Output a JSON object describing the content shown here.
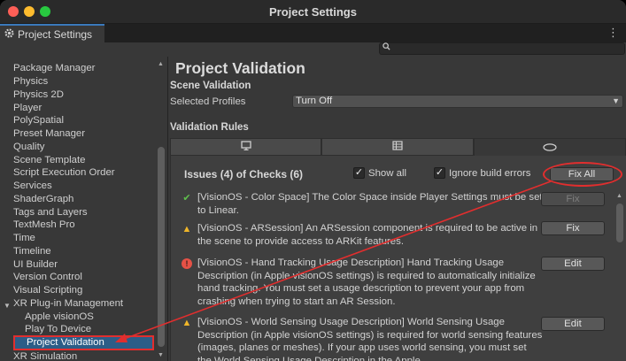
{
  "window": {
    "title": "Project Settings",
    "tab_label": "Project Settings",
    "tab_icon": "gear-icon",
    "menu_icon": "kebab-menu-icon",
    "search_placeholder": ""
  },
  "sidebar": {
    "items": [
      {
        "label": "Package Manager",
        "level": 0
      },
      {
        "label": "Physics",
        "level": 0
      },
      {
        "label": "Physics 2D",
        "level": 0
      },
      {
        "label": "Player",
        "level": 0
      },
      {
        "label": "PolySpatial",
        "level": 0
      },
      {
        "label": "Preset Manager",
        "level": 0
      },
      {
        "label": "Quality",
        "level": 0
      },
      {
        "label": "Scene Template",
        "level": 0
      },
      {
        "label": "Script Execution Order",
        "level": 0
      },
      {
        "label": "Services",
        "level": 0
      },
      {
        "label": "ShaderGraph",
        "level": 0
      },
      {
        "label": "Tags and Layers",
        "level": 0
      },
      {
        "label": "TextMesh Pro",
        "level": 0
      },
      {
        "label": "Time",
        "level": 0
      },
      {
        "label": "Timeline",
        "level": 0
      },
      {
        "label": "UI Builder",
        "level": 0
      },
      {
        "label": "Version Control",
        "level": 0
      },
      {
        "label": "Visual Scripting",
        "level": 0
      },
      {
        "label": "XR Plug-in Management",
        "level": 0
      },
      {
        "label": "Apple visionOS",
        "level": 1
      },
      {
        "label": "Play To Device",
        "level": 1
      },
      {
        "label": "Project Validation",
        "level": 1
      },
      {
        "label": "XR Simulation",
        "level": 0
      }
    ],
    "selected": "Project Validation"
  },
  "main": {
    "title": "Project Validation",
    "scene_validation": {
      "heading": "Scene Validation",
      "selected_profiles_label": "Selected Profiles",
      "selected_profiles_value": "Turn Off"
    },
    "validation_rules": {
      "heading": "Validation Rules",
      "platform_tabs": [
        {
          "icon": "monitor-icon",
          "active": false
        },
        {
          "icon": "grid-icon",
          "active": false
        },
        {
          "icon": "visionos-icon",
          "active": true
        }
      ],
      "summary": "Issues (4) of Checks (6)",
      "show_all_label": "Show all",
      "show_all_checked": true,
      "ignore_build_errors_label": "Ignore build errors",
      "ignore_build_errors_checked": true,
      "fix_all_label": "Fix All",
      "issues": [
        {
          "status": "ok",
          "icon": "checkmark-icon",
          "text": "[VisionOS - Color Space] The Color Space inside Player Settings must be set to Linear.",
          "action": "Fix",
          "action_enabled": false
        },
        {
          "status": "warning",
          "icon": "warning-icon",
          "text": "[VisionOS - ARSession] An ARSession component is required to be active in the scene to provide access to ARKit features.",
          "action": "Fix",
          "action_enabled": true
        },
        {
          "status": "error",
          "icon": "error-icon",
          "text": "[VisionOS - Hand Tracking Usage Description] Hand Tracking Usage Description (in Apple visionOS settings) is required to automatically initialize hand tracking. You must set a usage description to prevent your app from crashing when trying to start an AR Session.",
          "action": "Edit",
          "action_enabled": true
        },
        {
          "status": "warning",
          "icon": "warning-icon",
          "text": "[VisionOS - World Sensing Usage Description] World Sensing Usage Description (in Apple visionOS settings) is required for world sensing features (images, planes or meshes). If your app uses world sensing, you must set the World Sensing Usage Description in the Apple",
          "action": "Edit",
          "action_enabled": true
        }
      ]
    }
  },
  "annotation": {
    "color": "#e12e2e"
  }
}
